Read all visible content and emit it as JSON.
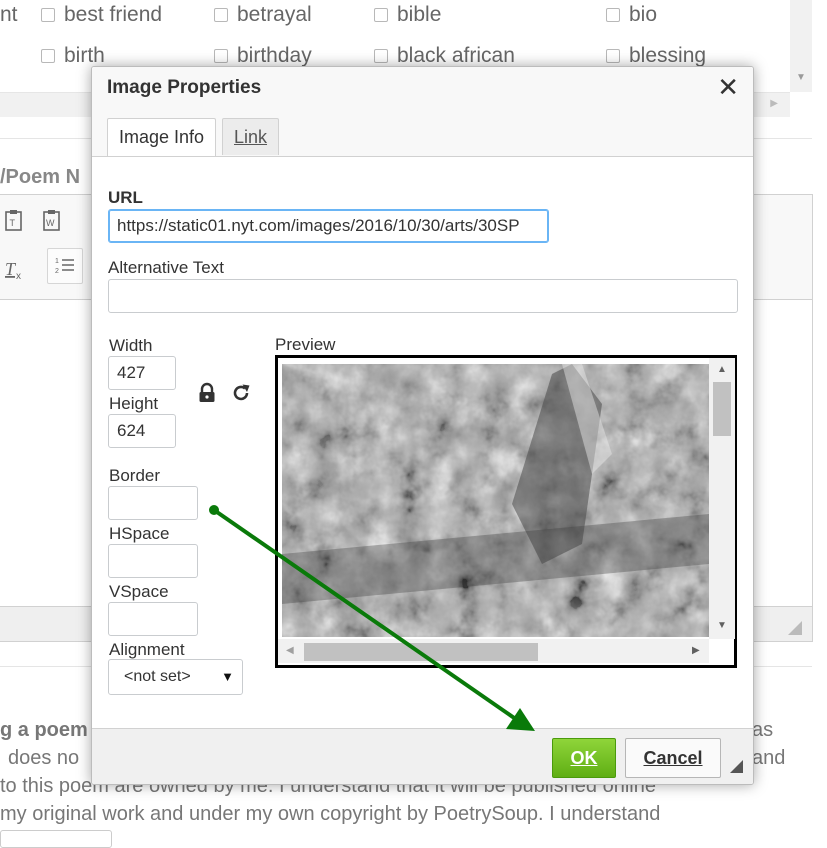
{
  "background": {
    "tags_row1": [
      "nt",
      "best friend",
      "betrayal",
      "bible",
      "bio"
    ],
    "tags_row2": [
      "birth",
      "birthday",
      "black african",
      "blessing"
    ],
    "poem_label": "/Poem N",
    "para_lines": [
      "g a poem",
      "does no",
      "to this poem are owned by me. I understand that it will be published online",
      "my original work and under my own copyright by PoetrySoup. I understand"
    ],
    "para_right": [
      "as",
      "and"
    ]
  },
  "dialog": {
    "title": "Image Properties",
    "close_symbol": "✕",
    "tabs": [
      {
        "label": "Image Info",
        "active": true
      },
      {
        "label": "Link",
        "active": false
      }
    ],
    "url_label": "URL",
    "url_value": "https://static01.nyt.com/images/2016/10/30/arts/30SP",
    "alt_label": "Alternative Text",
    "alt_value": "",
    "width_label": "Width",
    "width_value": "427",
    "height_label": "Height",
    "height_value": "624",
    "lock_icon": "lock-icon",
    "reset_icon": "reset-size-icon",
    "border_label": "Border",
    "border_value": "",
    "hspace_label": "HSpace",
    "hspace_value": "",
    "vspace_label": "VSpace",
    "vspace_value": "",
    "alignment_label": "Alignment",
    "alignment_value": "<not set>",
    "preview_label": "Preview",
    "ok_label": "OK",
    "cancel_label": "Cancel"
  },
  "colors": {
    "ok_green": "#6ab820",
    "annotation_arrow": "#0a7a0a",
    "focus_border": "#6ab5f5"
  }
}
